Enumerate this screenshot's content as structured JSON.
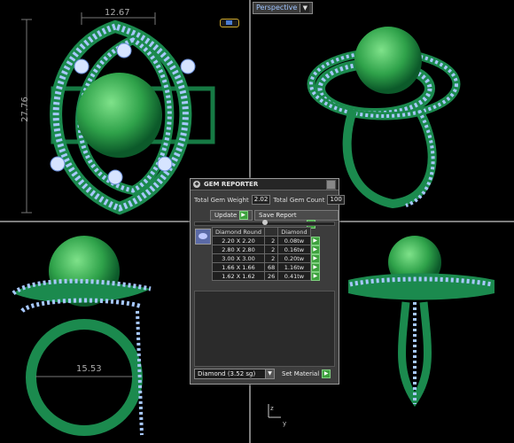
{
  "viewports": {
    "perspective_label": "Perspective",
    "top_width_dim": "12.67",
    "top_height_dim": "27.76",
    "front_width_dim": "15.53",
    "axis_z": "z",
    "axis_y": "y"
  },
  "gem_reporter": {
    "title": "GEM REPORTER",
    "total_weight_label": "Total Gem Weight",
    "total_weight_value": "2.02",
    "total_count_label": "Total Gem Count",
    "total_count_value": "100",
    "update_label": "Update",
    "save_report_label": "Save Report",
    "table": {
      "headers": [
        "Diamond Round",
        "",
        "Diamond"
      ],
      "rows": [
        {
          "size": "2.20 X 2.20",
          "count": "2",
          "weight": "0.08tw"
        },
        {
          "size": "2.80 X 2.80",
          "count": "2",
          "weight": "0.16tw"
        },
        {
          "size": "3.00 X 3.00",
          "count": "2",
          "weight": "0.20tw"
        },
        {
          "size": "1.66 X 1.66",
          "count": "68",
          "weight": "1.16tw"
        },
        {
          "size": "1.62 X 1.62",
          "count": "26",
          "weight": "0.41tw"
        }
      ]
    },
    "material_select": "Diamond   (3.52 sg)",
    "set_material_label": "Set Material"
  },
  "colors": {
    "metal": "#1f8a55",
    "pearl": "#3fbf5a",
    "gem": "#a7c8ff",
    "background": "#000000"
  }
}
